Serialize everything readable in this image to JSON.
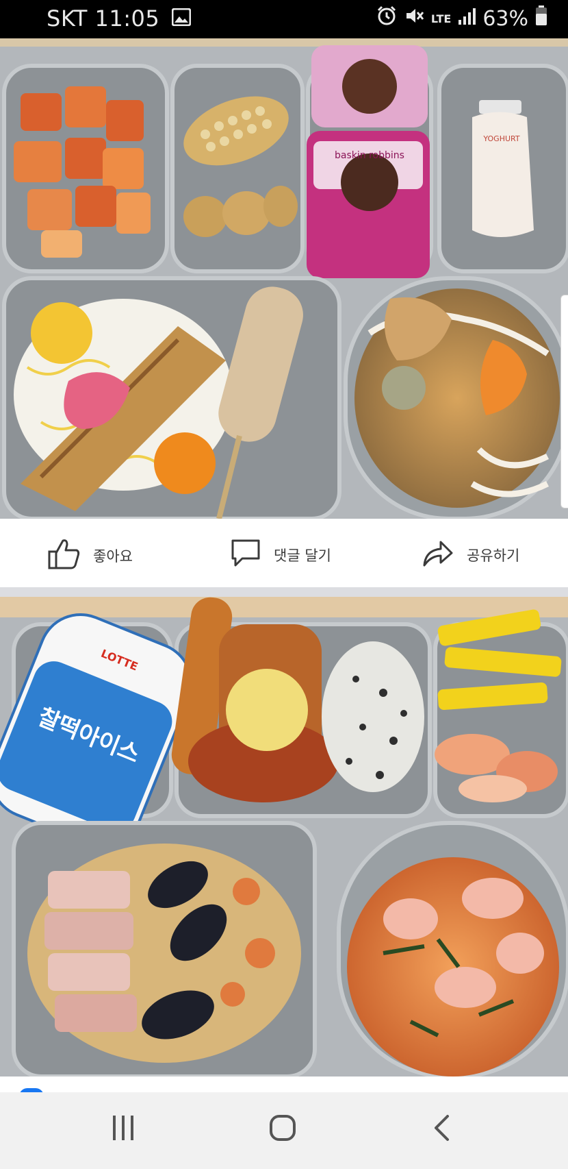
{
  "status_bar": {
    "carrier_time": "SKT 11:05",
    "network": "LTE",
    "battery": "63%"
  },
  "post_actions": {
    "like_label": "좋아요",
    "comment_label": "댓글 달기",
    "share_label": "공유하기"
  },
  "photo_1": {
    "cup_brand": "baskin robbins",
    "bottle_label": "YOGHURT"
  },
  "photo_2": {
    "package_brand": "LOTTE",
    "package_title": "찰떡아이스"
  },
  "icons": {
    "like": "thumbs-up-icon",
    "comment": "speech-bubble-icon",
    "share": "share-arrow-icon",
    "recents": "recent-apps-icon",
    "home": "home-icon",
    "back": "back-icon"
  },
  "colors": {
    "tray": "#9ea3a8",
    "status_bar": "#000000",
    "nav_bar": "#f1f1f1",
    "divider": "#dcdde1"
  }
}
